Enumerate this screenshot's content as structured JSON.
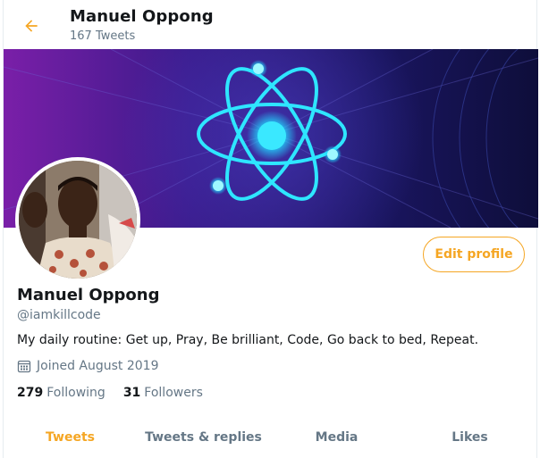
{
  "header": {
    "name": "Manuel Oppong",
    "tweet_count": "167 Tweets"
  },
  "profile": {
    "name": "Manuel Oppong",
    "handle": "@iamkillcode",
    "bio": "My daily routine: Get up, Pray, Be brilliant, Code, Go back to bed, Repeat.",
    "joined": "Joined August 2019",
    "following_count": "279",
    "following_label": "Following",
    "followers_count": "31",
    "followers_label": "Followers",
    "edit_label": "Edit profile"
  },
  "tabs": [
    {
      "label": "Tweets",
      "active": true
    },
    {
      "label": "Tweets & replies",
      "active": false
    },
    {
      "label": "Media",
      "active": false
    },
    {
      "label": "Likes",
      "active": false
    }
  ],
  "colors": {
    "accent": "#f5a623",
    "secondary_text": "#657786",
    "primary_text": "#14171a"
  },
  "icons": {
    "back": "back-arrow-icon",
    "calendar": "calendar-icon"
  }
}
